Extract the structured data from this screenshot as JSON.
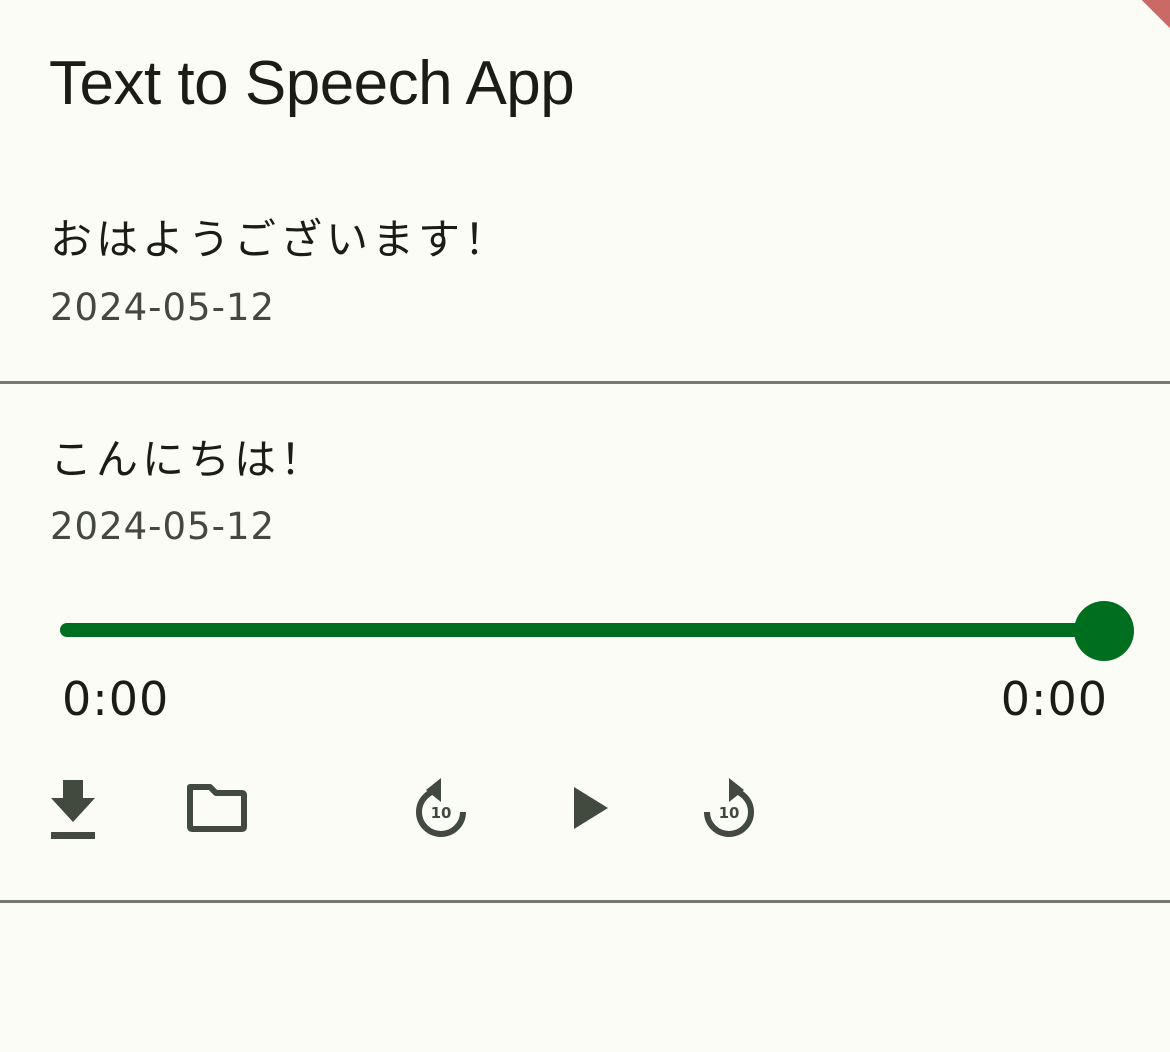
{
  "app_bar": {
    "title": "Text to Speech App"
  },
  "entries": [
    {
      "text": "おはようございます！",
      "date": "2024-05-12"
    },
    {
      "text": "こんにちは！",
      "date": "2024-05-12",
      "player": {
        "progress": 1.0,
        "current_time": "0:00",
        "total_time": "0:00"
      },
      "controls": {
        "download_icon": "download-icon",
        "folder_icon": "folder-icon",
        "replay_icon": "replay-10-icon",
        "replay_seconds": "10",
        "play_icon": "play-icon",
        "forward_icon": "forward-10-icon",
        "forward_seconds": "10"
      }
    }
  ],
  "colors": {
    "background": "#fbfcf6",
    "accent": "#006e1f",
    "icon": "#42493f",
    "divider": "#74796d",
    "secondary_text": "#44483e"
  }
}
